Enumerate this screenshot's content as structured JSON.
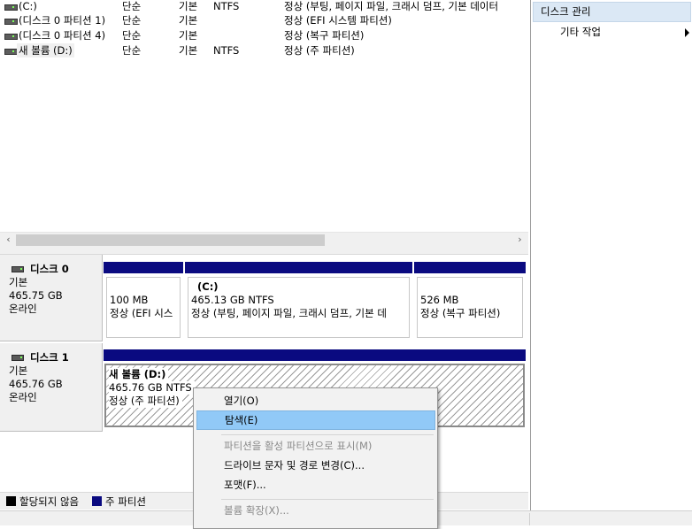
{
  "volume_list": {
    "rows": [
      {
        "name": "(C:)",
        "layout": "단순",
        "type": "기본",
        "fs": "NTFS",
        "status": "정상 (부팅, 페이지 파일, 크래시 덤프, 기본 데이터"
      },
      {
        "name": "(디스크 0 파티션 1)",
        "layout": "단순",
        "type": "기본",
        "fs": "",
        "status": "정상 (EFI 시스템 파티션)"
      },
      {
        "name": "(디스크 0 파티션 4)",
        "layout": "단순",
        "type": "기본",
        "fs": "",
        "status": "정상 (복구 파티션)"
      },
      {
        "name": "새 볼륨 (D:)",
        "layout": "단순",
        "type": "기본",
        "fs": "NTFS",
        "status": "정상 (주 파티션)"
      }
    ]
  },
  "scrollbar": {
    "left_arrow": "‹",
    "right_arrow": "›"
  },
  "disks": [
    {
      "name": "디스크 0",
      "type": "기본",
      "size": "465.75 GB",
      "state": "온라인",
      "partitions": [
        {
          "title": "",
          "line1": "100 MB",
          "line2": "정상 (EFI 시스"
        },
        {
          "title": "(C:)",
          "line1": "465.13 GB NTFS",
          "line2": "정상 (부팅, 페이지 파일, 크래시 덤프, 기본 데"
        },
        {
          "title": "",
          "line1": "526 MB",
          "line2": "정상 (복구 파티션)"
        }
      ]
    },
    {
      "name": "디스크 1",
      "type": "기본",
      "size": "465.76 GB",
      "state": "온라인",
      "partitions": [
        {
          "title": "새 볼륨  (D:)",
          "line1": "465.76 GB NTFS",
          "line2": "정상 (주 파티션)"
        }
      ]
    }
  ],
  "legend": {
    "unallocated": "할당되지 않음",
    "primary": "주 파티션",
    "unallocated_color": "#000000",
    "primary_color": "#0a0a80"
  },
  "actions": {
    "header": "디스크 관리",
    "more": "기타 작업"
  },
  "context_menu": {
    "items": [
      {
        "label": "열기(O)",
        "state": "normal"
      },
      {
        "label": "탐색(E)",
        "state": "highlighted"
      },
      {
        "label": "파티션을 활성 파티션으로 표시(M)",
        "state": "disabled"
      },
      {
        "label": "드라이브 문자 및 경로 변경(C)...",
        "state": "normal"
      },
      {
        "label": "포맷(F)...",
        "state": "normal"
      },
      {
        "label": "볼륨 확장(X)...",
        "state": "disabled"
      }
    ]
  },
  "colors": {
    "partition_bar": "#0a0a80",
    "menu_highlight": "#91c9f7",
    "actions_header": "#dbe8f5"
  }
}
